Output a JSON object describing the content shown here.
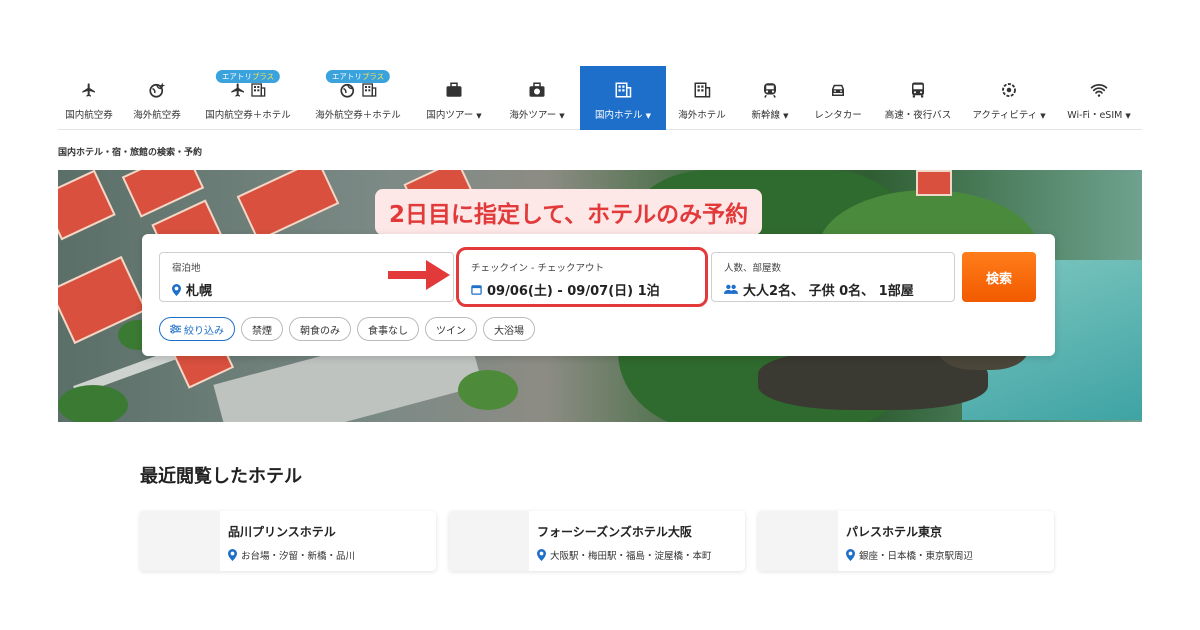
{
  "nav": [
    {
      "label": "国内航空券",
      "icon": "plane-icon",
      "caret": false,
      "active": false,
      "badge": ""
    },
    {
      "label": "海外航空券",
      "icon": "globe-plane-icon",
      "caret": false,
      "active": false,
      "badge": ""
    },
    {
      "label": "国内航空券＋ホテル",
      "icon": "plane-hotel-icon",
      "caret": false,
      "active": false,
      "badge": "エアトリプラス"
    },
    {
      "label": "海外航空券＋ホテル",
      "icon": "globe-hotel-icon",
      "caret": false,
      "active": false,
      "badge": "エアトリプラス"
    },
    {
      "label": "国内ツアー",
      "icon": "suitcase-icon",
      "caret": true,
      "active": false,
      "badge": ""
    },
    {
      "label": "海外ツアー",
      "icon": "suitcase-globe-icon",
      "caret": true,
      "active": false,
      "badge": ""
    },
    {
      "label": "国内ホテル",
      "icon": "hotel-icon",
      "caret": true,
      "active": true,
      "badge": ""
    },
    {
      "label": "海外ホテル",
      "icon": "building-icon",
      "caret": false,
      "active": false,
      "badge": ""
    },
    {
      "label": "新幹線",
      "icon": "train-icon",
      "caret": true,
      "active": false,
      "badge": ""
    },
    {
      "label": "レンタカー",
      "icon": "car-icon",
      "caret": false,
      "active": false,
      "badge": ""
    },
    {
      "label": "高速・夜行バス",
      "icon": "bus-icon",
      "caret": false,
      "active": false,
      "badge": ""
    },
    {
      "label": "アクティビティ",
      "icon": "activity-icon",
      "caret": true,
      "active": false,
      "badge": ""
    },
    {
      "label": "Wi-Fi・eSIM",
      "icon": "wifi-icon",
      "caret": true,
      "active": false,
      "badge": ""
    }
  ],
  "breadcrumb": "国内ホテル・宿・旅館の検索・予約",
  "callout": "2日目に指定して、ホテルのみ予約",
  "search": {
    "destination_label": "宿泊地",
    "destination_value": "札幌",
    "dates_label": "チェックイン - チェックアウト",
    "dates_value": "09/06(土) - 09/07(日) 1泊",
    "guests_label": "人数、部屋数",
    "guests_value": "大人2名、 子供 0名、 1部屋",
    "search_button": "検索"
  },
  "filters": [
    "絞り込み",
    "禁煙",
    "朝食のみ",
    "食事なし",
    "ツイン",
    "大浴場"
  ],
  "recent": {
    "title": "最近閲覧したホテル",
    "hotels": [
      {
        "name": "品川プリンスホテル",
        "area": "お台場・汐留・新橋・品川"
      },
      {
        "name": "フォーシーズンズホテル大阪",
        "area": "大阪駅・梅田駅・福島・淀屋橋・本町"
      },
      {
        "name": "パレスホテル東京",
        "area": "銀座・日本橋・東京駅周辺"
      }
    ]
  },
  "colors": {
    "accent": "#1e6fc9",
    "search": "#f25a00",
    "highlight": "#e23a3a"
  }
}
